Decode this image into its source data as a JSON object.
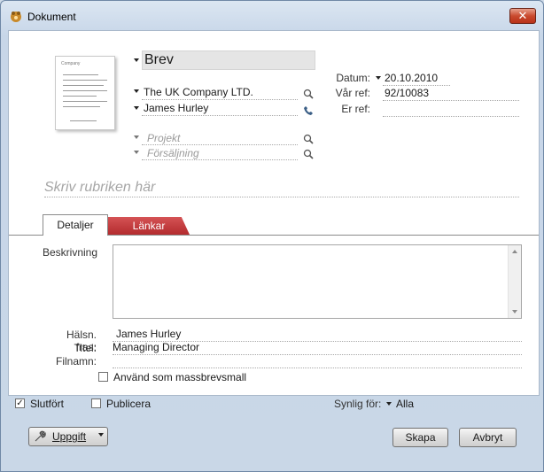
{
  "window": {
    "title": "Dokument",
    "close_glyph": "✕"
  },
  "document": {
    "title_value": "Brev",
    "company": "The UK Company LTD.",
    "contact": "James Hurley",
    "project_placeholder": "Projekt",
    "sales_placeholder": "Försäljning",
    "thumbnail_logo": "Company",
    "heading_placeholder": "Skriv rubriken här"
  },
  "refs": {
    "date_label": "Datum:",
    "date_value": "20.10.2010",
    "our_ref_label": "Vår ref:",
    "our_ref_value": "92/10083",
    "your_ref_label": "Er ref:",
    "your_ref_value": ""
  },
  "tabs": [
    {
      "label": "Detaljer",
      "active": true
    },
    {
      "label": "Länkar",
      "active": false
    }
  ],
  "details": {
    "description_label": "Beskrivning",
    "description_value": "",
    "greeting_label": "Hälsn. fras:",
    "greeting_value": "James  Hurley",
    "title_label": "Titel:",
    "title_value": "Managing Director",
    "filename_label": "Filnamn:",
    "filename_value": "",
    "mail_merge_label": "Använd som massbrevsmall",
    "mail_merge_checked": false
  },
  "status": {
    "completed_label": "Slutfört",
    "completed_checked": true,
    "publish_label": "Publicera",
    "publish_checked": false,
    "visible_for_label": "Synlig för:",
    "visible_for_value": "Alla"
  },
  "buttons": {
    "task": "Uppgift",
    "create": "Skapa",
    "cancel": "Avbryt"
  },
  "colors": {
    "links_tab": "#c0393b",
    "client_bg": "#ffffff",
    "frame_bg": "#c9d7e7"
  },
  "icons": [
    "app-icon",
    "search-icon",
    "phone-icon",
    "tool-icon",
    "dropdown-arrow-icon"
  ]
}
